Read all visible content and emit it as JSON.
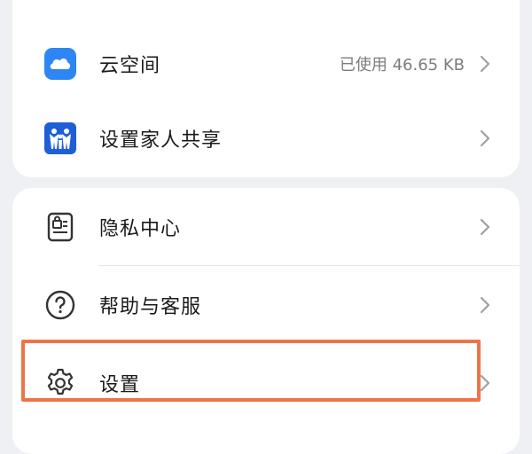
{
  "menu_top": {
    "items": [
      {
        "label": "云空间",
        "value": "已使用 46.65 KB",
        "icon": "cloud-icon"
      },
      {
        "label": "设置家人共享",
        "icon": "family-share-icon"
      }
    ]
  },
  "menu_bottom": {
    "items": [
      {
        "label": "隐私中心",
        "icon": "privacy-center-icon"
      },
      {
        "label": "帮助与客服",
        "icon": "help-icon"
      },
      {
        "label": "设置",
        "icon": "gear-icon"
      }
    ]
  },
  "colors": {
    "background": "#eff0f4",
    "card": "#ffffff",
    "highlight": "#ee7447",
    "cloud_blue": "#2e86f5",
    "family_blue": "#1f5fd6"
  }
}
